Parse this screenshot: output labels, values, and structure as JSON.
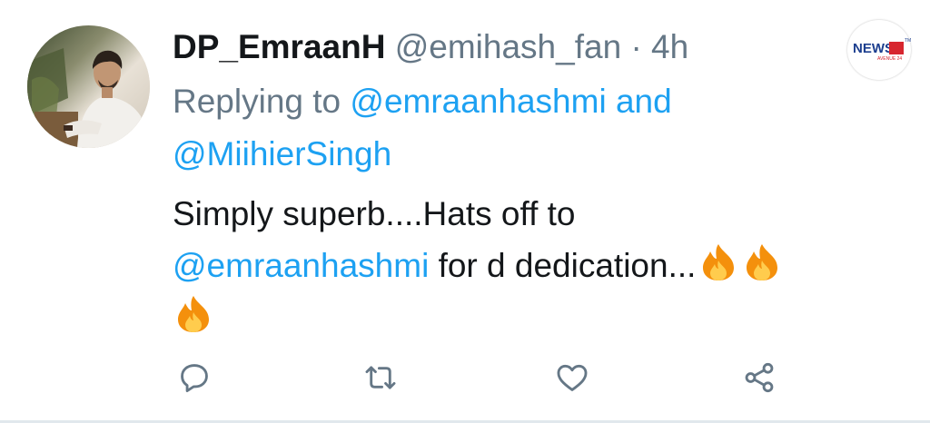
{
  "tweet": {
    "display_name": "DP_EmraanH",
    "handle": "@emihash_fan",
    "separator": "·",
    "time": "4h",
    "reply_prefix": "Replying to",
    "reply_mention_1": "@emraanhashmi",
    "reply_and": "and",
    "reply_mention_2": "@MiihierSingh",
    "body_line_1": "Simply superb....Hats off to",
    "body_mention": "@emraanhashmi",
    "body_rest": "for d dedication...",
    "emojis": [
      "fire-emoji",
      "fire-emoji",
      "fire-emoji"
    ]
  },
  "actions": [
    {
      "icon": "reply-icon"
    },
    {
      "icon": "retweet-icon"
    },
    {
      "icon": "like-icon"
    },
    {
      "icon": "share-icon"
    }
  ],
  "logo": {
    "brand": "NEWS",
    "sub": "AVENUE 24",
    "tm": "TM"
  },
  "colors": {
    "text": "#14171a",
    "secondary": "#657786",
    "link": "#1da1f2",
    "icon": "#657786"
  }
}
